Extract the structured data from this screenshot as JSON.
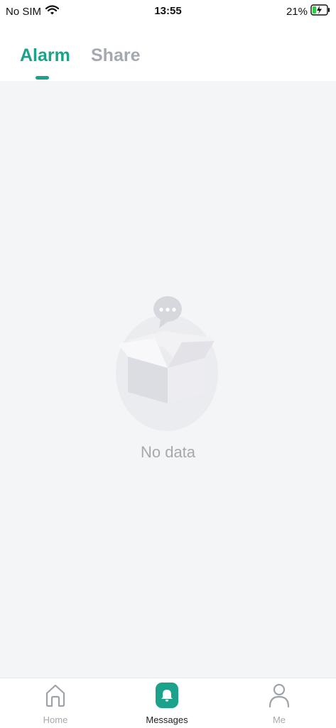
{
  "status_bar": {
    "carrier": "No SIM",
    "time": "13:55",
    "battery_percent": "21%",
    "icons": [
      "wifi-icon",
      "battery-charging-icon"
    ]
  },
  "tabs": [
    {
      "label": "Alarm",
      "active": true
    },
    {
      "label": "Share",
      "active": false
    }
  ],
  "empty_state": {
    "message": "No data",
    "icon": "empty-box-icon"
  },
  "tab_bar": {
    "items": [
      {
        "label": "Home",
        "icon": "home-icon",
        "active": false
      },
      {
        "label": "Messages",
        "icon": "bell-icon",
        "active": true
      },
      {
        "label": "Me",
        "icon": "person-icon",
        "active": false
      }
    ]
  },
  "colors": {
    "accent": "#1aa38a",
    "inactive_tab": "#a4a8b1",
    "background": "#f4f5f7",
    "muted_text": "#a7a9ae"
  }
}
